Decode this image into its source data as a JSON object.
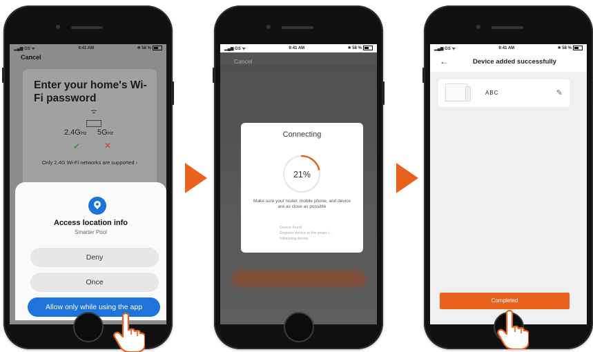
{
  "status_bar": {
    "carrier": "GS",
    "time": "9:41 AM",
    "battery": "58 %"
  },
  "screen1": {
    "cancel": "Cancel",
    "wifi_title": "Enter your home's Wi-Fi password",
    "freq_24": "2.4G",
    "freq_5": "5G",
    "freq_unit": "Hz",
    "support_note": "Only 2.4G Wi-Fi networks are supported",
    "permission_title": "Access location info",
    "permission_app": "Smarter Pool",
    "deny": "Deny",
    "once": "Once",
    "allow": "Allow only while using the app"
  },
  "screen2": {
    "cancel": "Cancel",
    "title": "Connecting",
    "progress": "21%",
    "progress_value": 21,
    "tip": "Make sure your router, mobile phone, and device are as close as possible",
    "steps": [
      "Device found",
      "Register device to the smart c...",
      "Initializing device"
    ]
  },
  "screen3": {
    "title": "Device added successfully",
    "device_name": "ABC",
    "completed": "Completed"
  },
  "colors": {
    "accent": "#e8621e",
    "primary_blue": "#1e73d8"
  }
}
